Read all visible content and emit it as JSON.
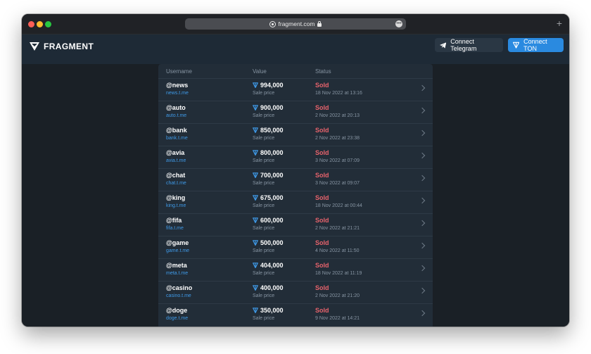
{
  "browser": {
    "url": "fragment.com",
    "new_tab": "+"
  },
  "header": {
    "logo_text": "FRAGMENT",
    "connect_telegram": "Connect Telegram",
    "connect_ton": "Connect TON"
  },
  "table": {
    "columns": [
      "Username",
      "Value",
      "Status"
    ],
    "rows": [
      {
        "username": "@news",
        "link": "news.t.me",
        "value": "994,000",
        "value_sub": "Sale price",
        "status": "Sold",
        "date": "18 Nov 2022 at 13:16"
      },
      {
        "username": "@auto",
        "link": "auto.t.me",
        "value": "900,000",
        "value_sub": "Sale price",
        "status": "Sold",
        "date": "2 Nov 2022 at 20:13"
      },
      {
        "username": "@bank",
        "link": "bank.t.me",
        "value": "850,000",
        "value_sub": "Sale price",
        "status": "Sold",
        "date": "2 Nov 2022 at 23:38"
      },
      {
        "username": "@avia",
        "link": "avia.t.me",
        "value": "800,000",
        "value_sub": "Sale price",
        "status": "Sold",
        "date": "3 Nov 2022 at 07:09"
      },
      {
        "username": "@chat",
        "link": "chat.t.me",
        "value": "700,000",
        "value_sub": "Sale price",
        "status": "Sold",
        "date": "3 Nov 2022 at 09:07"
      },
      {
        "username": "@king",
        "link": "king.t.me",
        "value": "675,000",
        "value_sub": "Sale price",
        "status": "Sold",
        "date": "18 Nov 2022 at 00:44"
      },
      {
        "username": "@fifa",
        "link": "fifa.t.me",
        "value": "600,000",
        "value_sub": "Sale price",
        "status": "Sold",
        "date": "2 Nov 2022 at 21:21"
      },
      {
        "username": "@game",
        "link": "game.t.me",
        "value": "500,000",
        "value_sub": "Sale price",
        "status": "Sold",
        "date": "4 Nov 2022 at 11:50"
      },
      {
        "username": "@meta",
        "link": "meta.t.me",
        "value": "404,000",
        "value_sub": "Sale price",
        "status": "Sold",
        "date": "18 Nov 2022 at 11:19"
      },
      {
        "username": "@casino",
        "link": "casino.t.me",
        "value": "400,000",
        "value_sub": "Sale price",
        "status": "Sold",
        "date": "2 Nov 2022 at 21:20"
      },
      {
        "username": "@doge",
        "link": "doge.t.me",
        "value": "350,000",
        "value_sub": "Sale price",
        "status": "Sold",
        "date": "9 Nov 2022 at 14:21"
      }
    ]
  },
  "colors": {
    "accent": "#2a8ae0",
    "sold": "#e8636c",
    "link": "#3f9ae8",
    "background": "#1a2026"
  },
  "icons": {
    "ton": "ton-icon",
    "telegram": "telegram-icon",
    "row_chevron": "chevron-right-icon"
  }
}
